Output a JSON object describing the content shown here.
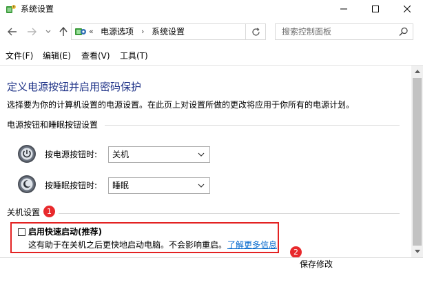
{
  "window": {
    "title": "系统设置",
    "app_icon": "power-options-icon"
  },
  "address_bar": {
    "chevrons": "«",
    "breadcrumbs": [
      "电源选项",
      "系统设置"
    ],
    "separator": "›"
  },
  "search": {
    "placeholder": "搜索控制面板"
  },
  "menu": {
    "items": [
      "文件(F)",
      "编辑(E)",
      "查看(V)",
      "工具(T)"
    ]
  },
  "main": {
    "title": "定义电源按钮并启用密码保护",
    "description": "选择要为你的计算机设置的电源设置。在此页上对设置所做的更改将应用于你所有的电源计划。",
    "power_section": {
      "title": "电源按钮和睡眠按钮设置",
      "rows": [
        {
          "label": "按电源按钮时:",
          "value": "关机",
          "icon": "power-button-icon"
        },
        {
          "label": "按睡眠按钮时:",
          "value": "睡眠",
          "icon": "sleep-button-icon"
        }
      ]
    },
    "shutdown_section": {
      "title": "关机设置",
      "fast_startup": {
        "label": "启用快速启动(推荐)",
        "description": "这有助于在关机之后更快地启动电脑。不会影响重启。",
        "link": "了解更多信息",
        "checked": false
      }
    }
  },
  "annotations": {
    "badge_1": "1",
    "badge_2": "2",
    "highlight_color": "#e32222"
  },
  "footer": {
    "save_label": "保存修改"
  },
  "colors": {
    "title_blue": "#1e3287",
    "link_blue": "#0066cc",
    "badge_red": "#e8292c"
  }
}
